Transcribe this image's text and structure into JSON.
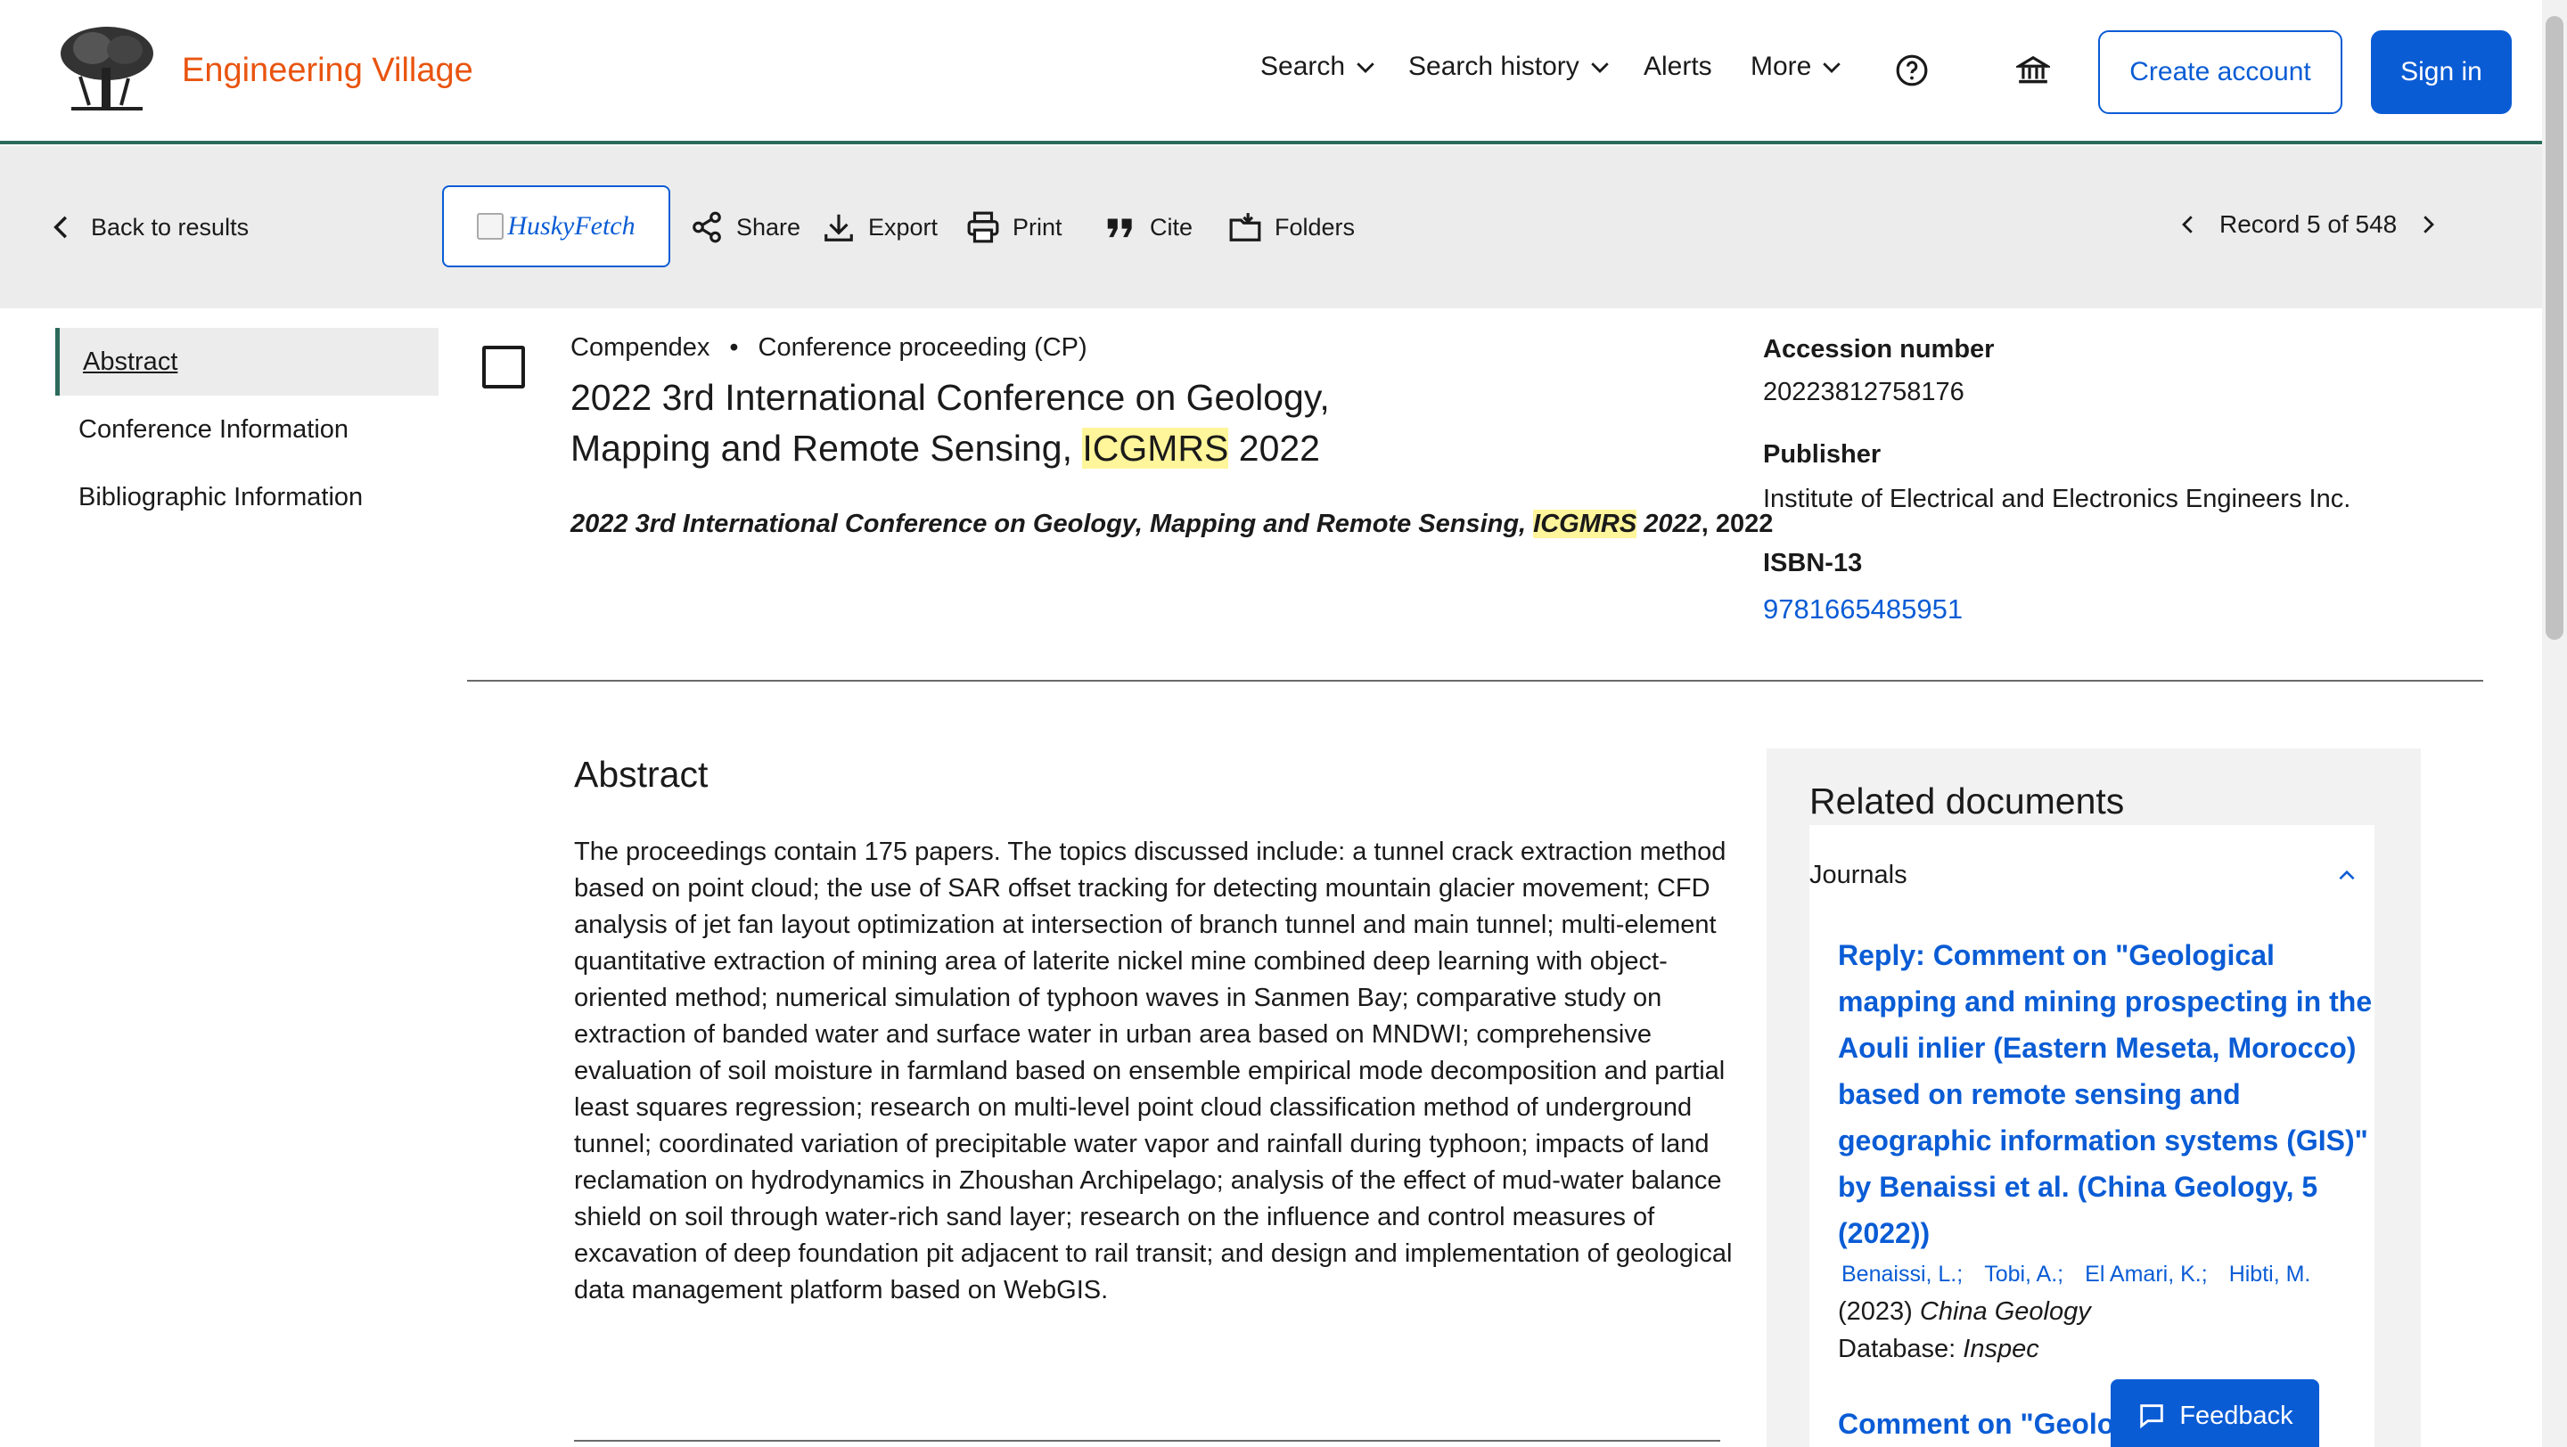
{
  "header": {
    "brand": "Engineering Village",
    "nav": {
      "search": "Search",
      "search_history": "Search history",
      "alerts": "Alerts",
      "more": "More"
    },
    "create_account": "Create account",
    "sign_in": "Sign in",
    "icons": [
      "help-icon",
      "institution-icon"
    ]
  },
  "toolbar": {
    "back": "Back to results",
    "husky_alt": "HuskyFetch",
    "share": "Share",
    "export": "Export",
    "print": "Print",
    "cite": "Cite",
    "folders": "Folders",
    "record": "Record 5 of 548"
  },
  "sidebar": {
    "items": [
      {
        "label": "Abstract"
      },
      {
        "label": "Conference Information"
      },
      {
        "label": "Bibliographic Information"
      }
    ]
  },
  "record": {
    "database": "Compendex",
    "separator": "•",
    "doc_type": "Conference proceeding (CP)",
    "title_part1": "2022 3rd International Conference on Geology, Mapping and Remote Sensing, ",
    "title_highlight": "ICGMRS",
    "title_part2": " 2022",
    "source_part1": "2022 3rd International Conference on Geology, Mapping and Remote Sensing, ",
    "source_highlight": "ICGMRS",
    "source_part2": " 2022",
    "source_year": ", 2022"
  },
  "details": {
    "accession_label": "Accession number",
    "accession_value": "20223812758176",
    "publisher_label": "Publisher",
    "publisher_value": "Institute of Electrical and Electronics Engineers Inc.",
    "isbn_label": "ISBN-13",
    "isbn_value": "9781665485951"
  },
  "abstract": {
    "heading": "Abstract",
    "text": "The proceedings contain 175 papers. The topics discussed include: a tunnel crack extraction method based on point cloud; the use of SAR offset tracking for detecting mountain glacier movement; CFD analysis of jet fan layout optimization at intersection of branch tunnel and main tunnel; multi-element quantitative extraction of mining area of laterite nickel mine combined deep learning with object-oriented method; numerical simulation of typhoon waves in Sanmen Bay; comparative study on extraction of banded water and surface water in urban area based on MNDWI; comprehensive evaluation of soil moisture in farmland based on ensemble empirical mode decomposition and partial least squares regression; research on multi-level point cloud classification method of underground tunnel; coordinated variation of precipitable water vapor and rainfall during typhoon; impacts of land reclamation on hydrodynamics in Zhoushan Archipelago; analysis of the effect of mud-water balance shield on soil through water-rich sand layer; research on the influence and control measures of excavation of deep foundation pit adjacent to rail transit; and design and implementation of geological data management platform based on WebGIS."
  },
  "related": {
    "heading": "Related documents",
    "tab": "Journals",
    "item1_title": "Reply: Comment on \"Geological mapping and mining prospecting in the Aouli inlier (Eastern Meseta, Morocco) based on remote sensing and geographic information systems (GIS)\" by Benaissi et al. (China Geology, 5 (2022))",
    "authors": [
      "Benaissi, L.;",
      "Tobi, A.;",
      "El Amari, K.;",
      "Hibti, M."
    ],
    "item1_year": "(2023) ",
    "item1_journal": "China Geology",
    "item1_db_label": "Database: ",
    "item1_db": "Inspec",
    "item2_title": "Comment on \"Geolo"
  },
  "feedback": "Feedback"
}
